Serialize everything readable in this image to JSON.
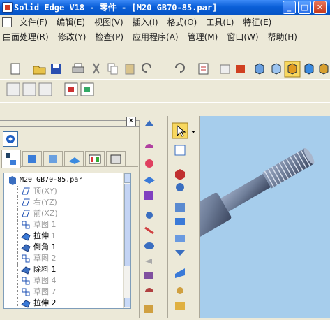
{
  "window": {
    "title": "Solid Edge V18 - 零件 - [M20 GB70-85.par]",
    "min": "_",
    "max": "□",
    "close": "✕"
  },
  "menu_row1": [
    "文件(F)",
    "编辑(E)",
    "视图(V)",
    "插入(I)",
    "格式(O)",
    "工具(L)",
    "特征(E)"
  ],
  "menu_row2": [
    "曲面处理(R)",
    "修改(Y)",
    "检查(P)",
    "应用程序(A)",
    "管理(M)",
    "窗口(W)",
    "帮助(H)"
  ],
  "pathfinder": {
    "close": "✕",
    "root": "M20 GB70-85.par",
    "items": [
      {
        "label": "顶(XY)",
        "dim": true,
        "icon": "plane-icon"
      },
      {
        "label": "右(YZ)",
        "dim": true,
        "icon": "plane-icon"
      },
      {
        "label": "前(XZ)",
        "dim": true,
        "icon": "plane-icon"
      },
      {
        "label": "草图 1",
        "dim": true,
        "icon": "sketch-icon"
      },
      {
        "label": "拉伸 1",
        "dim": false,
        "icon": "protrusion-icon"
      },
      {
        "label": "倒角 1",
        "dim": false,
        "icon": "chamfer-icon"
      },
      {
        "label": "草图 2",
        "dim": true,
        "icon": "sketch-icon"
      },
      {
        "label": "除料 1",
        "dim": false,
        "icon": "cutout-icon"
      },
      {
        "label": "草图 4",
        "dim": true,
        "icon": "sketch-icon"
      },
      {
        "label": "草图 7",
        "dim": true,
        "icon": "sketch-icon"
      },
      {
        "label": "拉伸 2",
        "dim": false,
        "icon": "protrusion-icon"
      }
    ]
  },
  "colors": {
    "titlebar": "#0a5fd8",
    "viewport": "#a6cdec",
    "part": "#7e8ca6"
  }
}
